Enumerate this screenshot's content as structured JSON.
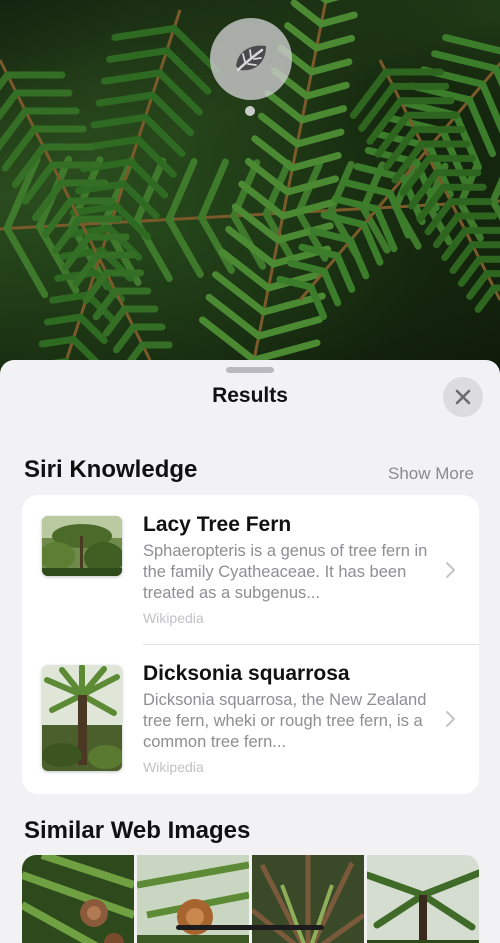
{
  "sheet": {
    "title": "Results",
    "close_icon": "xmark-icon"
  },
  "siri_knowledge": {
    "heading": "Siri Knowledge",
    "show_more": "Show More",
    "items": [
      {
        "title": "Lacy Tree Fern",
        "description": "Sphaeropteris is a genus of tree fern in the family Cyatheaceae. It has been treated as a subgenus...",
        "source": "Wikipedia"
      },
      {
        "title": "Dicksonia squarrosa",
        "description": "Dicksonia squarrosa, the New Zealand tree fern, wheki or rough tree fern, is a common tree fern...",
        "source": "Wikipedia"
      }
    ]
  },
  "similar_images": {
    "heading": "Similar Web Images"
  },
  "icons": {
    "lookup": "leaf-icon",
    "chevron": "chevron-right-icon"
  }
}
